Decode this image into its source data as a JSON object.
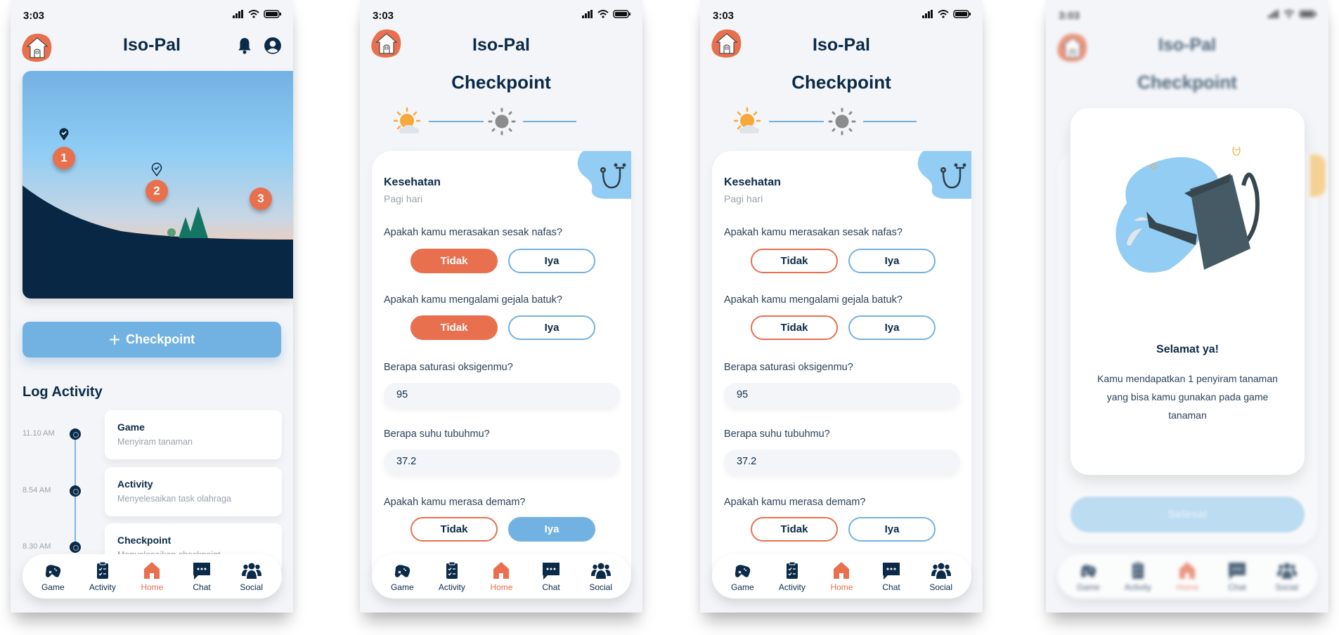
{
  "app": {
    "title": "Iso-Pal",
    "status_time": "3:03"
  },
  "colors": {
    "primary_dark": "#0b2a47",
    "accent_orange": "#e8704f",
    "accent_blue": "#72b2e2",
    "background": "#f3f5f8"
  },
  "nav": {
    "items": [
      {
        "label": "Game",
        "icon": "gamepad-icon",
        "active": false
      },
      {
        "label": "Activity",
        "icon": "clipboard-list-icon",
        "active": false
      },
      {
        "label": "Home",
        "icon": "home-icon",
        "active": true
      },
      {
        "label": "Chat",
        "icon": "chat-bubble-icon",
        "active": false
      },
      {
        "label": "Social",
        "icon": "users-icon",
        "active": false
      }
    ]
  },
  "home": {
    "map_markers": [
      "1",
      "2",
      "3"
    ],
    "checkpoint_button": "Checkpoint",
    "log_title": "Log Activity",
    "log": [
      {
        "time": "11.10 AM",
        "title": "Game",
        "subtitle": "Menyiram tanaman"
      },
      {
        "time": "8.54 AM",
        "title": "Activity",
        "subtitle": "Menyelesaikan task olahraga"
      },
      {
        "time": "8.30 AM",
        "title": "Checkpoint",
        "subtitle": "Menyelesaikan checkpoint"
      }
    ]
  },
  "checkpoint": {
    "title": "Checkpoint",
    "timeline": [
      "morning-sun-cloud-icon",
      "sun-icon",
      "moon-icon"
    ],
    "section_title": "Kesehatan",
    "section_subtitle": "Pagi hari",
    "option_no": "Tidak",
    "option_yes": "Iya",
    "questions": {
      "q1": "Apakah kamu merasakan sesak nafas?",
      "q2": "Apakah kamu mengalami gejala batuk?",
      "q3": "Berapa saturasi oksigenmu?",
      "q4": "Berapa suhu tubuhmu?",
      "q5": "Apakah kamu merasa demam?"
    },
    "screen_filled": {
      "q1": "Tidak",
      "q2": "Tidak",
      "oxygen": "95",
      "temperature": "37.2",
      "q5": "Iya"
    },
    "screen_empty": {
      "q1": null,
      "q2": null,
      "oxygen": "95",
      "temperature": "37.2",
      "q5": null
    }
  },
  "reward_modal": {
    "title": "Selamat ya!",
    "body": "Kamu mendapatkan 1 penyiram tanaman yang bisa kamu gunakan pada game tanaman",
    "button": "Selesai"
  }
}
